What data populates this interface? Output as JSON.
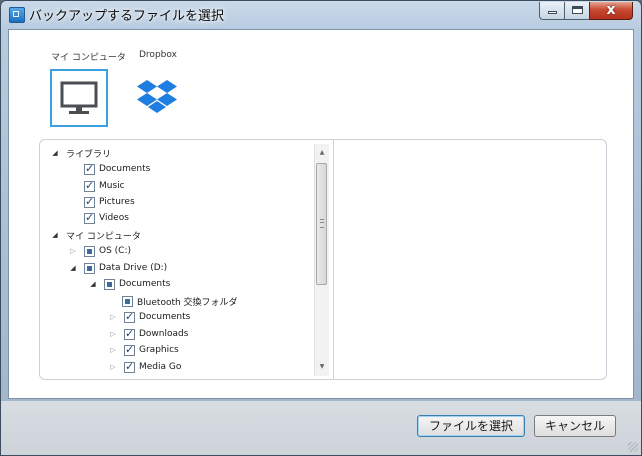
{
  "window": {
    "title": "バックアップするファイルを選択",
    "close_glyph": "x"
  },
  "sources": [
    {
      "label": "マイ コンピュータ",
      "icon": "monitor-icon",
      "selected": true
    },
    {
      "label": "Dropbox",
      "icon": "dropbox-icon",
      "selected": false
    }
  ],
  "tree": {
    "rows": [
      {
        "label": "ライブラリ",
        "expander": "expanded",
        "checkbox": "none"
      },
      {
        "label": "Documents",
        "expander": "none",
        "checkbox": "checked"
      },
      {
        "label": "Music",
        "expander": "none",
        "checkbox": "checked"
      },
      {
        "label": "Pictures",
        "expander": "none",
        "checkbox": "checked"
      },
      {
        "label": "Videos",
        "expander": "none",
        "checkbox": "checked"
      },
      {
        "label": "マイ コンピュータ",
        "expander": "expanded",
        "checkbox": "none"
      },
      {
        "label": "OS (C:)",
        "expander": "collapsed",
        "checkbox": "partial"
      },
      {
        "label": "Data Drive (D:)",
        "expander": "expanded",
        "checkbox": "partial"
      },
      {
        "label": "Documents",
        "expander": "expanded",
        "checkbox": "partial"
      },
      {
        "label": "Bluetooth 交換フォルダ",
        "expander": "none",
        "checkbox": "partial"
      },
      {
        "label": "Documents",
        "expander": "collapsed",
        "checkbox": "checked"
      },
      {
        "label": "Downloads",
        "expander": "collapsed",
        "checkbox": "checked"
      },
      {
        "label": "Graphics",
        "expander": "collapsed",
        "checkbox": "checked"
      },
      {
        "label": "Media Go",
        "expander": "collapsed",
        "checkbox": "checked"
      }
    ]
  },
  "buttons": {
    "select_label": "ファイルを選択",
    "cancel_label": "キャンセル"
  },
  "colors": {
    "accent": "#3a9fdc",
    "dropbox": "#1e7de0"
  }
}
